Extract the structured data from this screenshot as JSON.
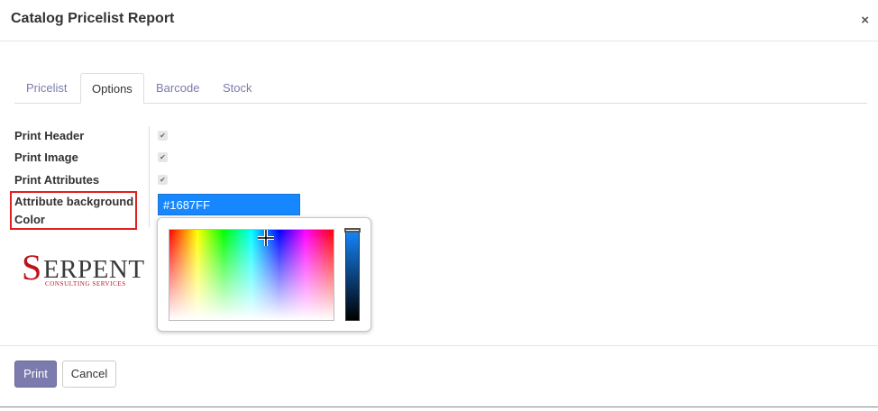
{
  "dialog": {
    "title": "Catalog Pricelist Report",
    "close_glyph": "×"
  },
  "tabs": [
    {
      "label": "Pricelist",
      "active": false
    },
    {
      "label": "Options",
      "active": true
    },
    {
      "label": "Barcode",
      "active": false
    },
    {
      "label": "Stock",
      "active": false
    }
  ],
  "options": {
    "print_header_label": "Print Header",
    "print_header_checked": true,
    "print_image_label": "Print Image",
    "print_image_checked": true,
    "print_attributes_label": "Print Attributes",
    "print_attributes_checked": true,
    "attr_bg_label_line1": "Attribute background",
    "attr_bg_label_line2": "Color",
    "attr_bg_value": "#1687FF"
  },
  "logo": {
    "initial": "S",
    "rest": "ERPENT",
    "subtitle": "CONSULTING SERVICES"
  },
  "footer": {
    "print_label": "Print",
    "cancel_label": "Cancel"
  },
  "colors": {
    "accent": "#7c7bad",
    "selected_color": "#1687ff",
    "highlight_border": "#e02020",
    "logo_red": "#c0111a"
  }
}
